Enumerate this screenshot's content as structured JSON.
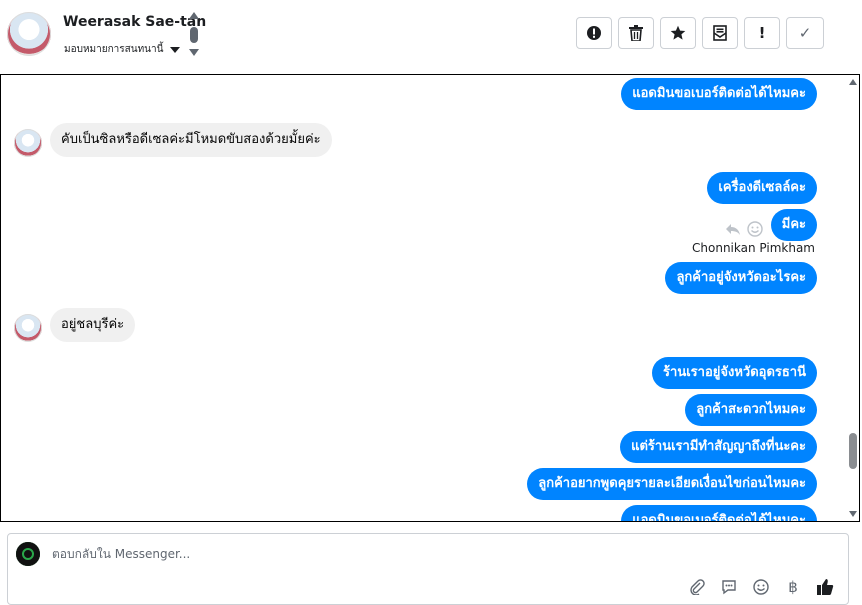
{
  "header": {
    "contact_name": "Weerasak Sae-tan",
    "assign_label": "มอบหมายการสนทนานี้",
    "toolbar": {
      "alert_icon": "!",
      "done_icon": "✓"
    }
  },
  "messages": {
    "m1": "แอดมินขอเบอร์ติดต่อได้ไหมคะ",
    "m2": "คับเป็นซิลหรือดีเซลค่ะมีโหมดขับสองด้วยมั้ยค่ะ",
    "m3": "เครื่องดีเซลล์คะ",
    "m4": "มีคะ",
    "m5": "ลูกค้าอยู่จังหวัดอะไรคะ",
    "m6": "อยู่ชลบุรีค่ะ",
    "m7": "ร้านเราอยู่จังหวัดอุดรธานี",
    "m8": "ลูกค้าสะดวกไหมคะ",
    "m9": "แต่ร้านเรามีทำสัญญาถึงที่นะคะ",
    "m10": "ลูกค้าอยากพูดคุยรายละเอียดเงื่อนไขก่อนไหมคะ",
    "m11": "แอดมินขอเบอร์ติดต่อได้ไหมคะ",
    "sender_name": "Chonnikan Pimkham"
  },
  "composer": {
    "placeholder": "ตอบกลับใน Messenger...",
    "baht_icon": "฿"
  },
  "colors": {
    "outgoing_bubble": "#0084ff",
    "incoming_bubble": "#f0f0f0"
  }
}
